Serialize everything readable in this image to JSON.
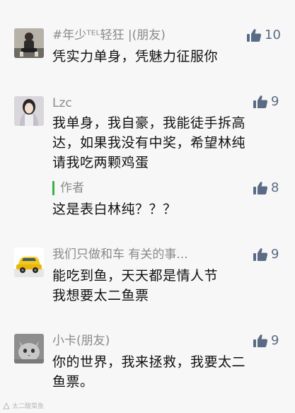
{
  "comments": [
    {
      "username": "#年少ᵀᴱᴸ轻狂 |(朋友)",
      "likes": "10",
      "lines": [
        "凭实力单身，凭魅力征服你"
      ],
      "avatar_icon": "man-photo-avatar"
    },
    {
      "username": "Lzc",
      "likes": "9",
      "lines": [
        "我单身，我自豪，我能徒手拆高",
        "达，如果我没有中奖，希望林纯",
        "请我吃两颗鸡蛋"
      ],
      "avatar_icon": "woman-photo-avatar",
      "reply": {
        "name": "作者",
        "likes": "8",
        "text": "这是表白林纯？？？"
      }
    },
    {
      "username": "我们只做和车 有关的事...",
      "likes": "9",
      "lines": [
        "能吃到鱼，天天都是情人节",
        "我想要太二鱼票"
      ],
      "avatar_icon": "yellow-car-avatar"
    },
    {
      "username": "小卡(朋友)",
      "likes": "9",
      "lines": [
        "你的世界，我来拯救，我要太二",
        "鱼票。"
      ],
      "avatar_icon": "cat-photo-avatar"
    }
  ],
  "watermark": {
    "text": "太二酸菜鱼",
    "icon": "logo-mark"
  },
  "colors": {
    "background": "#f7f7f7",
    "username": "#8a8a8a",
    "like": "#5a6b86",
    "reply_bar": "#3cb04a"
  }
}
